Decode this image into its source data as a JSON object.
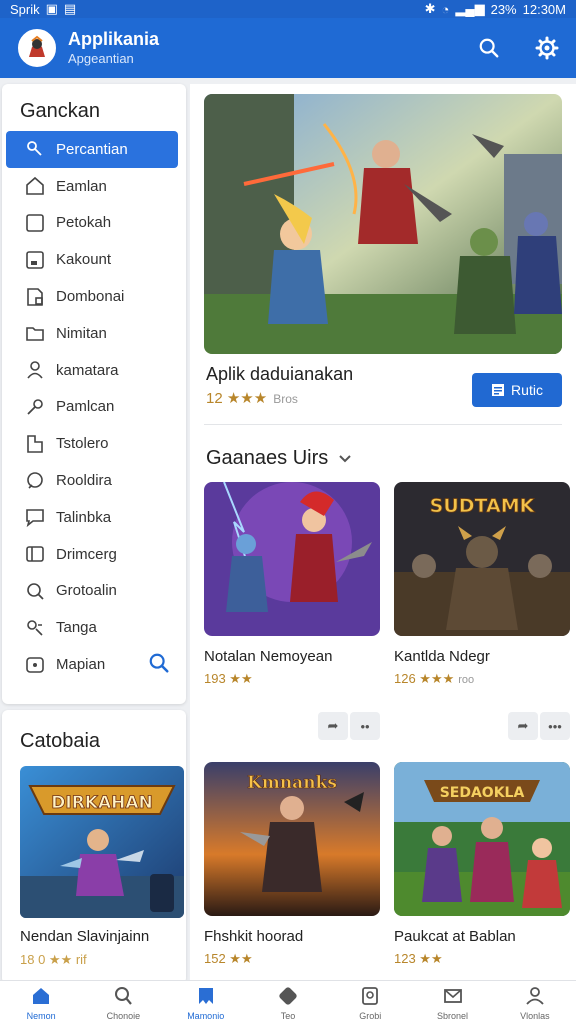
{
  "status": {
    "carrier": "Sprik",
    "battery": "23%",
    "time": "12:30M"
  },
  "app": {
    "title": "Applikania",
    "subtitle": "Apgeantian"
  },
  "sidebar": {
    "title": "Ganckan",
    "items": [
      {
        "label": "Percantian",
        "icon": "search-person-icon"
      },
      {
        "label": "Eamlan",
        "icon": "home-icon"
      },
      {
        "label": "Petokah",
        "icon": "square-icon"
      },
      {
        "label": "Kakount",
        "icon": "account-icon"
      },
      {
        "label": "Dombonai",
        "icon": "document-icon"
      },
      {
        "label": "Nimitan",
        "icon": "folder-icon"
      },
      {
        "label": "kamatara",
        "icon": "person-icon"
      },
      {
        "label": "Pamlcan",
        "icon": "key-icon"
      },
      {
        "label": "Tstolero",
        "icon": "tag-icon"
      },
      {
        "label": "Rooldira",
        "icon": "chat-icon"
      },
      {
        "label": "Talinbka",
        "icon": "speech-icon"
      },
      {
        "label": "Drimcerg",
        "icon": "card-icon"
      },
      {
        "label": "Grotoalin",
        "icon": "magnifier-icon"
      },
      {
        "label": "Tanga",
        "icon": "group-icon"
      },
      {
        "label": "Mapian",
        "icon": "map-icon"
      }
    ]
  },
  "category": {
    "title": "Catobaia",
    "item_name": "Nendan Slavinjainn",
    "rating": "18 0 ★★ rif"
  },
  "featured": {
    "name": "Aplik daduianakan",
    "rating": "12 ★★★",
    "rating_meta": "Bros",
    "button": "Rutic"
  },
  "section": {
    "title": "Gaanaes Uirs"
  },
  "cards": [
    {
      "name": "Notalan Nemoyean",
      "rating": "193 ★★",
      "meta": ""
    },
    {
      "name": "Kantlda Ndegr",
      "rating": "126 ★★★",
      "meta": "roo",
      "overlay": "SUDTAMK"
    },
    {
      "name": "Fhshkit hoorad",
      "rating": "152 ★★",
      "meta": "",
      "overlay": "Kmnanks"
    },
    {
      "name": "Paukcat at Bablan",
      "rating": "123 ★★",
      "meta": "",
      "overlay": "SEDAOKLA"
    }
  ],
  "bottom_nav": [
    {
      "label": "Nemon",
      "icon": "home-icon"
    },
    {
      "label": "Chonoie",
      "icon": "search-icon"
    },
    {
      "label": "Mamonio",
      "icon": "bookmark-icon"
    },
    {
      "label": "Teo",
      "icon": "dice-icon"
    },
    {
      "label": "Grobi",
      "icon": "badge-icon"
    },
    {
      "label": "Sbronel",
      "icon": "mail-icon"
    },
    {
      "label": "Vlonlas",
      "icon": "profile-icon"
    }
  ],
  "colors": {
    "primary": "#1f6ad4",
    "accent_star": "#c9a04a"
  }
}
